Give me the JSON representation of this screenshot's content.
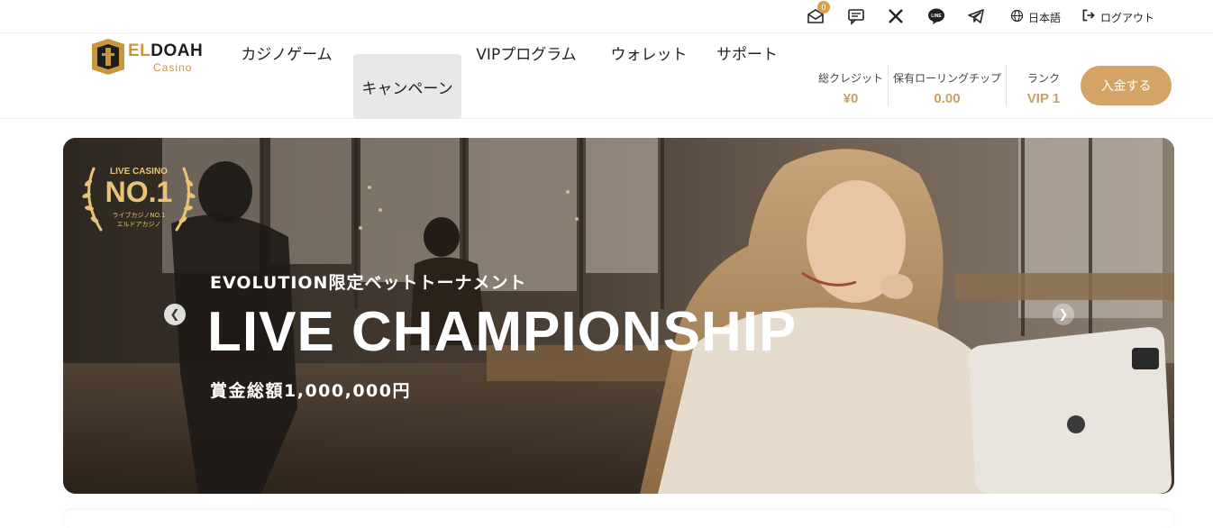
{
  "topbar": {
    "mail_badge_count": "0",
    "language_label": "日本語",
    "logout_label": "ログアウト",
    "icons": [
      "mail-icon",
      "chat-icon",
      "x-icon",
      "line-icon",
      "telegram-icon",
      "globe-icon",
      "logout-icon"
    ]
  },
  "header": {
    "logo": {
      "word": "DOAH",
      "prefix": "EL",
      "sub": "Casino"
    },
    "nav": [
      {
        "label": "カジノゲーム"
      },
      {
        "label": "キャンペーン"
      },
      {
        "label": "VIPプログラム"
      },
      {
        "label": "ウォレット"
      },
      {
        "label": "サポート"
      }
    ],
    "stats": {
      "credit_label": "総クレジット",
      "credit_value": "¥0",
      "chip_label": "保有ローリングチップ",
      "chip_value": "0.00",
      "rank_label": "ランク",
      "rank_value": "VIP 1"
    },
    "deposit_label": "入金する"
  },
  "banner": {
    "award": {
      "line1": "LIVE CASINO",
      "line2": "NO.1",
      "line3": "ライブカジノNO.1",
      "line4": "エルドアカジノ"
    },
    "subtitle": "EVOLUTION限定ベットトーナメント",
    "title": "LIVE CHAMPIONSHIP",
    "prize": "賞金総額1,000,000円",
    "prev_arrow": "❮",
    "next_arrow": "❯"
  },
  "colors": {
    "accent": "#d4a366",
    "gold_text": "#c9a064",
    "nav_active_bg": "#e8e8e8",
    "badge": "#d8a04a"
  }
}
